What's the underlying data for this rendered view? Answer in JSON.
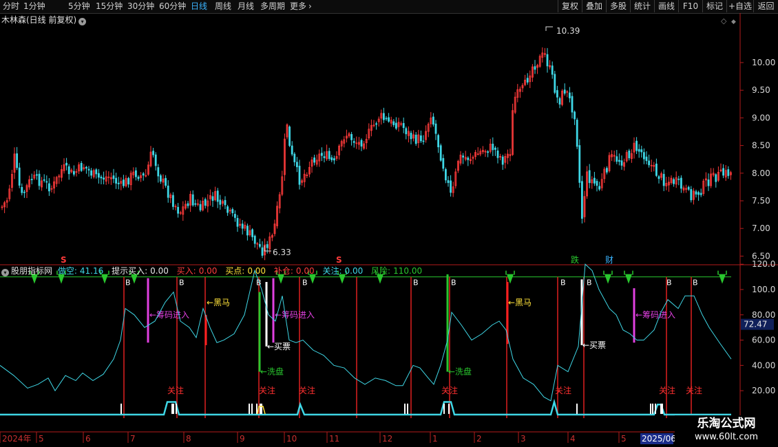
{
  "toolbar": {
    "periods": [
      "分时",
      "1分钟",
      "5分钟",
      "15分钟",
      "30分钟",
      "60分钟",
      "日线",
      "周线",
      "月线",
      "多周期",
      "更多"
    ],
    "active_period": "日线",
    "more_chevron": "›",
    "right_buttons": [
      "复权",
      "叠加",
      "多股",
      "统计",
      "画线",
      "F10",
      "标记",
      "+自选",
      "返回"
    ]
  },
  "main_chart": {
    "title": "木林森(日线 前复权)",
    "title_icon": "chevron-down-icon",
    "y_axis_ticks": [
      "10.00",
      "9.50",
      "9.00",
      "8.50",
      "8.00",
      "7.50",
      "7.00",
      "6.50"
    ],
    "high_label": "10.39",
    "low_label": "6.33",
    "markers": {
      "s1": "S",
      "s2": "S",
      "die": "跌",
      "cai": "财"
    }
  },
  "indicator": {
    "name": "股朋指标网",
    "fields": [
      {
        "label": "做空:",
        "value": "41.16",
        "color": "#3fd7e6"
      },
      {
        "label": "提示买入:",
        "value": "0.00",
        "color": "#e8e8e8"
      },
      {
        "label": "买入:",
        "value": "0.00",
        "color": "#ff3d3d"
      },
      {
        "label": "买点:",
        "value": "0.00",
        "color": "#ffe23a"
      },
      {
        "label": "补仓:",
        "value": "0.00",
        "color": "#ff3d3d"
      },
      {
        "label": "关注:",
        "value": "0.00",
        "color": "#3fd7e6"
      },
      {
        "label": "风险:",
        "value": "110.00",
        "color": "#29c72e"
      }
    ],
    "y_axis_ticks": [
      "120.0",
      "100.0",
      "80.00",
      "60.00",
      "40.00",
      "20.00"
    ],
    "current_value": "72.47",
    "signals": {
      "b": "B",
      "heima": "黑马",
      "choumajinru": "筹码进入",
      "maipiao": "买票",
      "xipan": "洗盘",
      "guanzhu": "关注"
    }
  },
  "x_axis": {
    "labels": [
      "2024年",
      "5",
      "6",
      "7",
      "8",
      "9",
      "10",
      "11",
      "12",
      "1",
      "2",
      "3",
      "4",
      "5"
    ],
    "highlight_label": "2025/06"
  },
  "watermark": {
    "text": "乐淘公式网",
    "url": "www.60lt.com"
  },
  "colors": {
    "up": "#ff3b3b",
    "down": "#3fd7e6",
    "rsi": "#3fd7e6",
    "signal_green": "#29c72e",
    "magenta": "#e040e0"
  }
}
